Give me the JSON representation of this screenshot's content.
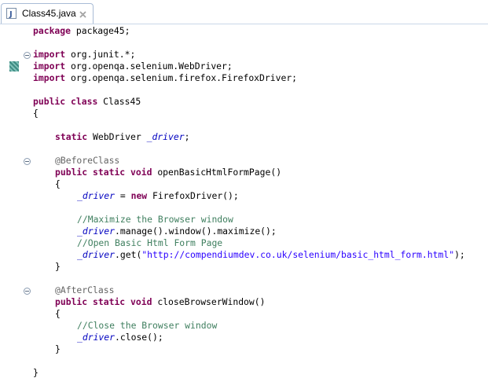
{
  "tab": {
    "title": "Class45.java",
    "close_icon": "close-icon",
    "file_icon": "java-file-icon"
  },
  "code": {
    "line1": {
      "kw": "package",
      "rest": " package45;"
    },
    "line2": {
      "kw": "import",
      "rest": " org.junit.*;"
    },
    "line3": {
      "kw": "import",
      "rest": " org.openqa.selenium.WebDriver;"
    },
    "line4": {
      "kw": "import",
      "rest": " org.openqa.selenium.firefox.FirefoxDriver;"
    },
    "line5": {
      "kw1": "public",
      "kw2": "class",
      "rest": " Class45"
    },
    "line6": {
      "text": "{"
    },
    "line7": {
      "kw": "static",
      "type": " WebDriver ",
      "field": "_driver",
      "end": ";"
    },
    "line8": {
      "ann": "@BeforeClass"
    },
    "line9": {
      "kw1": "public",
      "kw2": "static",
      "kw3": "void",
      "rest": " openBasicHtmlFormPage()"
    },
    "line10": {
      "text": "{"
    },
    "line11": {
      "field": "_driver",
      "mid": " = ",
      "kw": "new",
      "rest": " FirefoxDriver();"
    },
    "line12": {
      "comment": "//Maximize the Browser window"
    },
    "line13": {
      "field": "_driver",
      "rest": ".manage().window().maximize();"
    },
    "line14": {
      "comment": "//Open Basic Html Form Page"
    },
    "line15": {
      "field": "_driver",
      "pre": ".get(",
      "str": "\"http://compendiumdev.co.uk/selenium/basic_html_form.html\"",
      "end": ");"
    },
    "line16": {
      "text": "}"
    },
    "line17": {
      "ann": "@AfterClass"
    },
    "line18": {
      "kw1": "public",
      "kw2": "static",
      "kw3": "void",
      "rest": " closeBrowserWindow()"
    },
    "line19": {
      "text": "{"
    },
    "line20": {
      "comment": "//Close the Browser window"
    },
    "line21": {
      "field": "_driver",
      "rest": ".close();"
    },
    "line22": {
      "text": "}"
    },
    "line23": {
      "text": "}"
    }
  },
  "colors": {
    "keyword": "#7f0055",
    "field": "#0000c0",
    "string": "#2a00ff",
    "comment": "#3f7f5f",
    "annotation": "#646464"
  }
}
